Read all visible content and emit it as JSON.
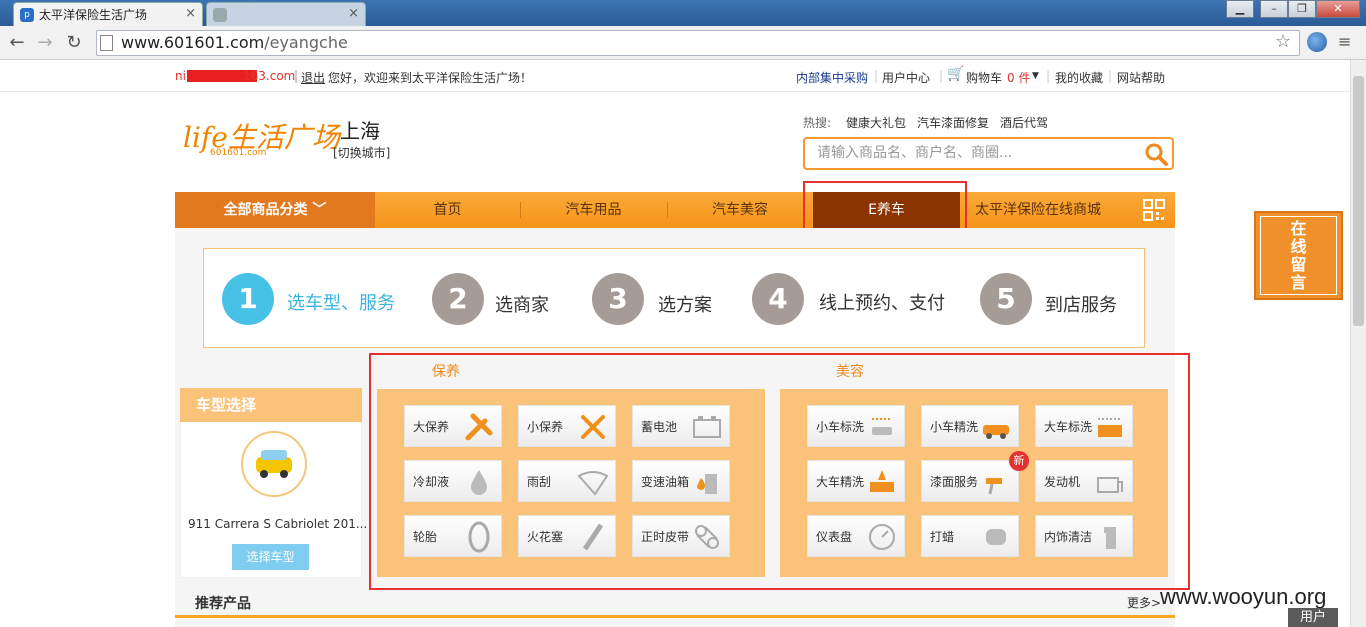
{
  "browser": {
    "tab_title": "太平洋保险生活广场",
    "tab2_title": "",
    "url_domain": "www.601601.com",
    "url_path": "/eyangche"
  },
  "topbar": {
    "email_prefix": "ni",
    "email_suffix": "163.com",
    "logout": "退出",
    "welcome": "您好，欢迎来到太平洋保险生活广场！",
    "links": [
      "内部集中采购",
      "用户中心",
      "购物车",
      "0 件",
      "我的收藏",
      "网站帮助"
    ]
  },
  "header": {
    "logo_text": "life生活广场",
    "logo_sub": "601601.com",
    "city": "上海",
    "switch_city": "[切换城市]",
    "hot_label": "热搜:",
    "hot_items": [
      "健康大礼包",
      "汽车漆面修复",
      "酒后代驾"
    ],
    "search_placeholder": "请输入商品名、商户名、商圈..."
  },
  "nav": {
    "all_categories": "全部商品分类",
    "items": [
      "首页",
      "汽车用品",
      "汽车美容",
      "E养车",
      "太平洋保险在线商城"
    ]
  },
  "steps": [
    {
      "num": "1",
      "label": "选车型、服务"
    },
    {
      "num": "2",
      "label": "选商家"
    },
    {
      "num": "3",
      "label": "选方案"
    },
    {
      "num": "4",
      "label": "线上预约、支付"
    },
    {
      "num": "5",
      "label": "到店服务"
    }
  ],
  "car_select": {
    "title": "车型选择",
    "car_name": "911 Carrera S Cabriolet 201...",
    "button": "选择车型"
  },
  "maintenance": {
    "title": "保养",
    "items": [
      "大保养",
      "小保养",
      "蓄电池",
      "冷却液",
      "雨刮",
      "变速油箱",
      "轮胎",
      "火花塞",
      "正时皮带"
    ]
  },
  "beauty": {
    "title": "美容",
    "items": [
      "小车标洗",
      "小车精洗",
      "大车标洗",
      "大车精洗",
      "漆面服务",
      "发动机",
      "仪表盘",
      "打蜡",
      "内饰清洁"
    ],
    "new_badge": "新"
  },
  "float_box": {
    "text": [
      "在",
      "线",
      "留",
      "言"
    ]
  },
  "recommend": {
    "title": "推荐产品",
    "more": "更多>"
  },
  "overlay": {
    "watermark": "www.wooyun.org",
    "user_button": "用户"
  },
  "colors": {
    "accent": "#f59418",
    "active_nav": "#8b3300",
    "highlight_box": "#e5312f",
    "step_active": "#48c1e6"
  }
}
